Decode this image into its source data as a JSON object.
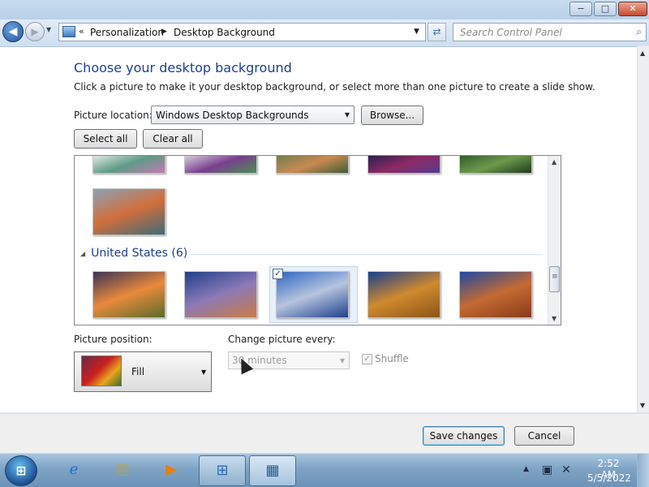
{
  "window": {
    "caption": {
      "minimize": "−",
      "maximize": "□",
      "close": "✕"
    }
  },
  "nav": {
    "back_icon": "arrow-left",
    "forward_icon": "arrow-right",
    "breadcrumb": [
      "Personalization",
      "Desktop Background"
    ],
    "breadcrumb_prefix": "«",
    "search_placeholder": "Search Control Panel"
  },
  "page": {
    "heading": "Choose your desktop background",
    "subtitle": "Click a picture to make it your desktop background, or select more than one picture to create a slide show.",
    "location_label": "Picture location:",
    "location_value": "Windows Desktop Backgrounds",
    "browse_label": "Browse...",
    "select_all_label": "Select all",
    "clear_all_label": "Clear all"
  },
  "gallery": {
    "group_name": "United States (6)",
    "top_row_colors": [
      [
        "#e8ebe6",
        "#5e9b86",
        "#c67ab4"
      ],
      [
        "#d9d2e0",
        "#7a3f8e",
        "#4a8f52"
      ],
      [
        "#6d7f4a",
        "#c98a53",
        "#3f5b36"
      ],
      [
        "#281e4d",
        "#8d2a64",
        "#563a8e"
      ],
      [
        "#2f5a2c",
        "#6c9a4b",
        "#1e3a1e"
      ]
    ],
    "single_thumb_colors": [
      "#8aa3b7",
      "#d26e3c",
      "#3d6b77"
    ],
    "us_thumbs": [
      {
        "name": "us-sunset-fields",
        "colors": [
          "#3b3357",
          "#e98a3c",
          "#5b6b2a"
        ]
      },
      {
        "name": "us-lighthouse",
        "colors": [
          "#1f3f8a",
          "#8d7ab8",
          "#c97b41"
        ]
      },
      {
        "name": "us-rock-reflection",
        "colors": [
          "#2e66c3",
          "#b6c4de",
          "#1d3f8a"
        ]
      },
      {
        "name": "us-hay-bale",
        "colors": [
          "#173f8e",
          "#d08a2e",
          "#8a5417"
        ]
      },
      {
        "name": "us-delicate-arch",
        "colors": [
          "#1d4aa0",
          "#c46a34",
          "#8a3a1a"
        ]
      }
    ],
    "selected_index": 2
  },
  "position": {
    "label": "Picture position:",
    "value": "Fill"
  },
  "change": {
    "label": "Change picture every:",
    "value": "30 minutes",
    "shuffle_label": "Shuffle"
  },
  "footer": {
    "save_label": "Save changes",
    "cancel_label": "Cancel"
  },
  "taskbar": {
    "start_label": "⊞",
    "time": "2:52 AM",
    "date": "5/5/2022"
  },
  "colors": {
    "heading": "#1e3f8f",
    "taskbar": "#7fa3c4"
  }
}
